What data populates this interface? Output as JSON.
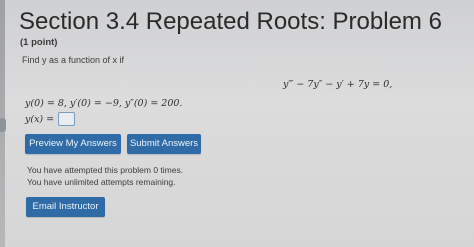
{
  "header": {
    "title": "Section 3.4 Repeated Roots: Problem 6",
    "points": "(1 point)"
  },
  "problem": {
    "prompt": "Find y as a function of x if",
    "equation": "y‴ − 7y″ − y′ + 7y = 0,",
    "initial_conditions": "y(0) = 8,  y′(0) = −9,  y″(0) = 200.",
    "answer_label": "y(x) ="
  },
  "answer": {
    "value": ""
  },
  "buttons": {
    "preview": "Preview My Answers",
    "submit": "Submit Answers",
    "email": "Email Instructor"
  },
  "status": {
    "attempts": "You have attempted this problem 0 times.",
    "remaining": "You have unlimited attempts remaining."
  },
  "colors": {
    "button_bg": "#2f6ba6",
    "button_text": "#eef3f9",
    "page_bg": "#d9d9da"
  }
}
